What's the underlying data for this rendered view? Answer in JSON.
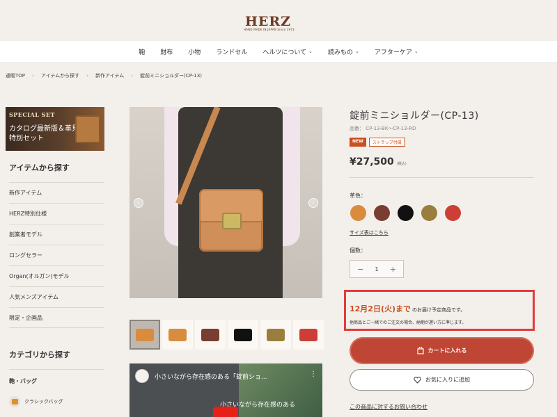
{
  "header": {
    "logo_text": "HERZ",
    "logo_sub": "HAND MADE IN JAPAN Since 1973"
  },
  "nav": {
    "items": [
      "鞄",
      "財布",
      "小物",
      "ランドセル",
      "ヘルツについて",
      "読みもの",
      "アフターケア"
    ]
  },
  "breadcrumb": [
    "通販TOP",
    "アイテムから探す",
    "新作アイテム",
    "錠前ミニショルダー(CP-13)"
  ],
  "banner": {
    "title": "SPECIAL SET",
    "line1": "カタログ最新版＆革見本",
    "line2": "特別セット"
  },
  "sidebar": {
    "heading_items": "アイテムから探す",
    "items": [
      "新作アイテム",
      "HERZ特別仕様",
      "創業者モデル",
      "ロングセラー",
      "Organ(オルガン)モデル",
      "人気メンズアイテム",
      "限定・企画品"
    ],
    "heading_category": "カテゴリから探す",
    "category_group": "鞄・バッグ",
    "category_sub": "クラシックバッグ"
  },
  "video": {
    "title": "小さいながら存在感のある「錠前ショ...",
    "caption": "小さいながら存在感のある"
  },
  "product": {
    "title": "錠前ミニショルダー(CP-13)",
    "code": "品番： CP-13-BK〜CP-13-RD",
    "badge_new": "NEW",
    "badge_strap": "ストラップ付属",
    "price": "¥27,500",
    "tax": "(税込)",
    "color_label": "革色：",
    "colors": [
      "#d98c3e",
      "#7a3d32",
      "#111111",
      "#9a7e3e",
      "#cc3e36"
    ],
    "size_link": "サイズ表はこちら",
    "qty_label": "個数：",
    "qty_minus": "−",
    "qty_value": "1",
    "qty_plus": "+",
    "delivery_date": "12月2日(火)まで",
    "delivery_rest": "のお届け予定商品です。",
    "delivery_note": "他商品とご一緒でのご注文の場合、納期が遅い方に準じます。",
    "cart_button": "カートに入れる",
    "fav_button": "お気に入りに追加",
    "inquiry_link": "この商品に対するお問い合わせ"
  },
  "thumb_colors": [
    "#d98c3e",
    "#d98c3e",
    "#7a3d32",
    "#111111",
    "#9a7e3e",
    "#cc3e36"
  ]
}
